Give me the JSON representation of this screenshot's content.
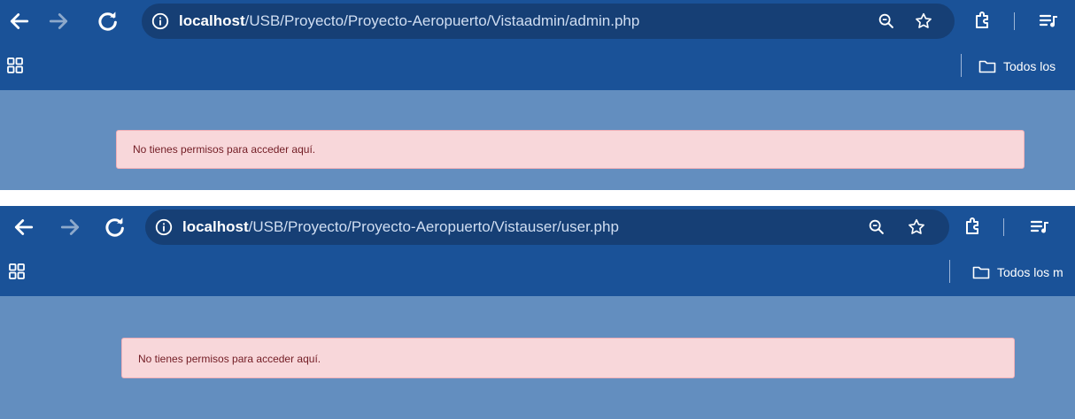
{
  "screens": [
    {
      "url_host": "localhost",
      "url_path": "/USB/Proyecto/Proyecto-Aeropuerto/Vistaadmin/admin.php",
      "bookmark_folder": "Todos los",
      "alert_message": "No tienes permisos para acceder aquí."
    },
    {
      "url_host": "localhost",
      "url_path": "/USB/Proyecto/Proyecto-Aeropuerto/Vistauser/user.php",
      "bookmark_folder": "Todos los m",
      "alert_message": "No tienes permisos para acceder aquí."
    }
  ],
  "icons": [
    "back-icon",
    "forward-icon",
    "reload-icon",
    "site-info-icon",
    "zoom-icon",
    "star-icon",
    "extensions-icon",
    "reading-list-icon",
    "apps-icon",
    "folder-icon"
  ],
  "colors": {
    "toolbar": "#1a5298",
    "omnibox": "#163f75",
    "page_background": "#638ebf",
    "alert_background": "#f8d7da",
    "alert_border": "#f1b0b7",
    "alert_text": "#721c24"
  }
}
